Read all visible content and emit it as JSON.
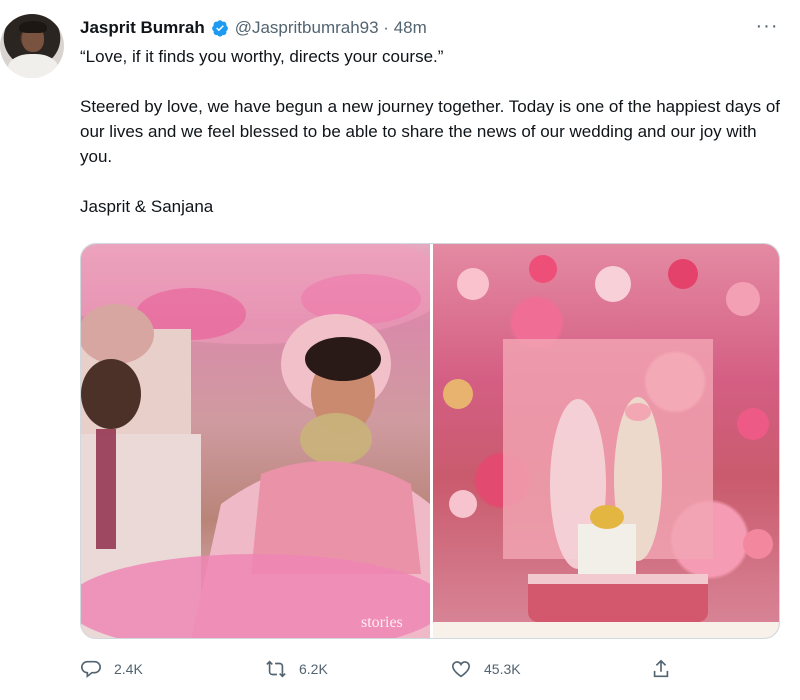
{
  "tweet": {
    "author_name": "Jasprit Bumrah",
    "handle_time": "@Jaspritbumrah93 · 48m",
    "more_glyph": "···",
    "quote": "“Love, if it finds you worthy, directs your course.”",
    "body": "Steered by love, we have begun a new journey together. Today is one of the happiest days of our lives and we feel blessed to be able to share the news of our wedding and our joy with you.",
    "signature": "Jasprit & Sanjana"
  },
  "actions": {
    "replies": "2.4K",
    "retweets": "6.2K",
    "likes": "45.3K"
  },
  "icons": [
    "verified-icon",
    "more-icon",
    "reply-icon",
    "retweet-icon",
    "like-icon",
    "share-icon"
  ],
  "colors": {
    "verified": "#1d9bf0",
    "secondary_text": "#536471"
  }
}
